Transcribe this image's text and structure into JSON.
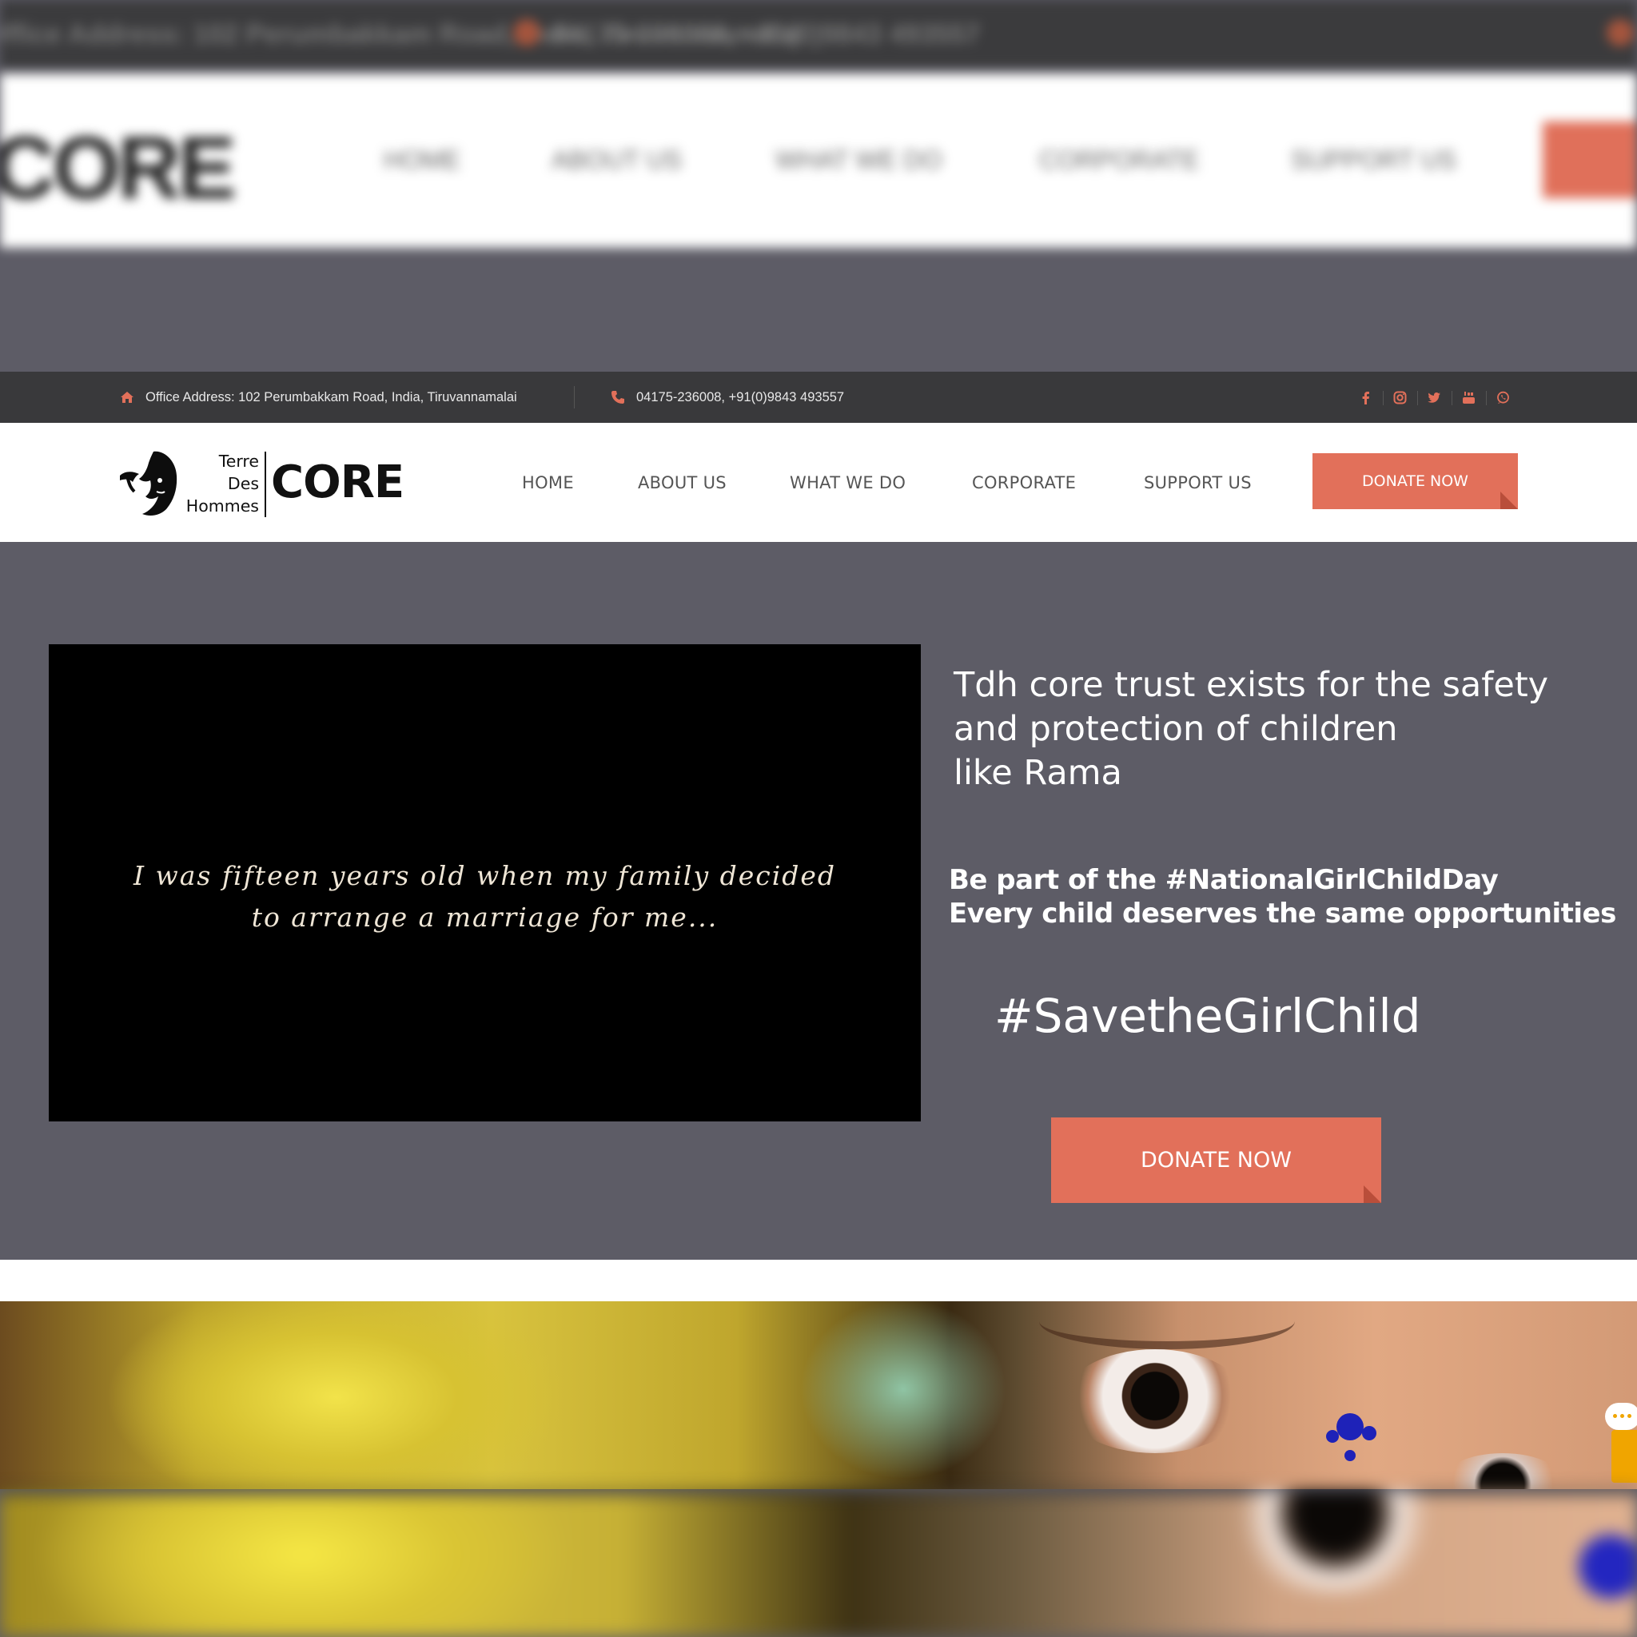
{
  "topbar": {
    "address": "Office Address: 102 Perumbakkam Road, India, Tiruvannamalai",
    "phone": "04175-236008, +91(0)9843 493557",
    "social_icons": [
      "facebook-icon",
      "instagram-icon",
      "twitter-icon",
      "youtube-icon",
      "whatsapp-icon"
    ]
  },
  "logo": {
    "line1": "Terre",
    "line2": "Des",
    "line3": "Hommes",
    "wordmark": "CORE"
  },
  "nav": {
    "items": [
      {
        "label": "HOME"
      },
      {
        "label": "ABOUT US"
      },
      {
        "label": "WHAT WE DO"
      },
      {
        "label": "CORPORATE"
      },
      {
        "label": "SUPPORT US"
      }
    ],
    "donate_label": "DONATE NOW"
  },
  "hero": {
    "video_caption_line1": "I was fifteen years old when my family decided",
    "video_caption_line2": "to arrange a marriage for me...",
    "lead_line1": "Tdh core trust exists for the safety",
    "lead_line2": "and protection of children",
    "lead_line3": "like Rama",
    "sub_line1": "Be part of the #NationalGirlChildDay",
    "sub_line2": "Every child deserves the same opportunities",
    "hashtag": "#SavetheGirlChild",
    "donate_label": "DONATE NOW"
  },
  "colors": {
    "accent": "#e2705a",
    "topbar_bg": "#39393b",
    "hero_bg": "#5d5c66",
    "chat_widget": "#f0a500"
  }
}
